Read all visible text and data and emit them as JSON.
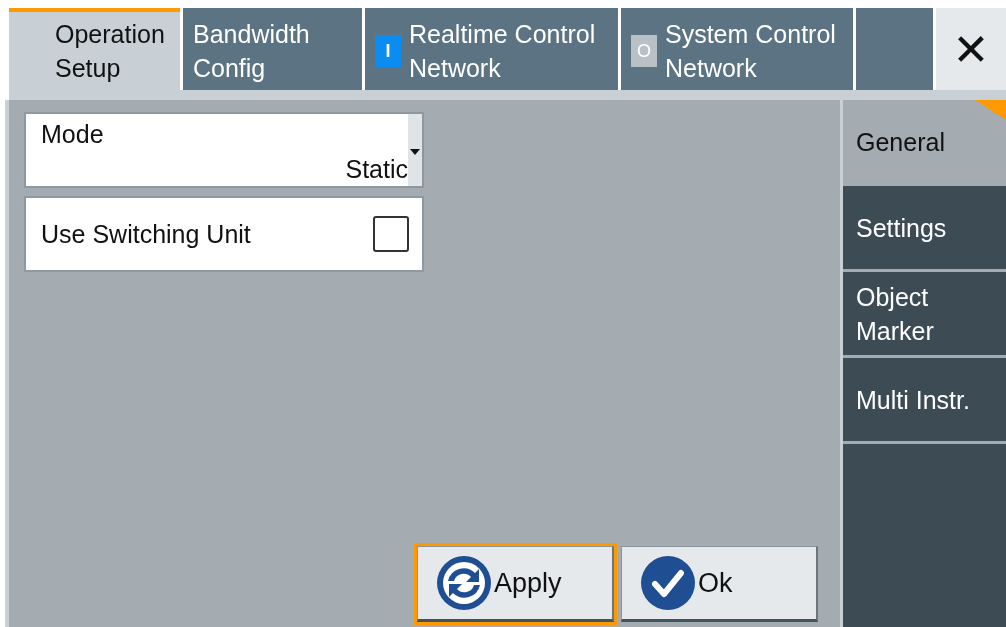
{
  "tabs": [
    {
      "label": "Operation Setup",
      "selected": true
    },
    {
      "label": "Bandwidth Config",
      "selected": false
    },
    {
      "label": "Realtime Control Network",
      "selected": false,
      "indicator": {
        "text": "I",
        "on": true
      }
    },
    {
      "label": "System Control Network",
      "selected": false,
      "indicator": {
        "text": "O",
        "on": false
      }
    }
  ],
  "close_button": {
    "label": "✕"
  },
  "mode": {
    "label": "Mode",
    "value": "Static"
  },
  "use_switching_unit": {
    "label": "Use Switching Unit",
    "checked": false
  },
  "side_tabs": [
    {
      "label": "General",
      "selected": true
    },
    {
      "label": "Settings",
      "selected": false
    },
    {
      "label": "Object Marker",
      "selected": false
    },
    {
      "label": "Multi Instr.",
      "selected": false
    }
  ],
  "buttons": [
    {
      "label": "Apply",
      "kind": "apply",
      "focused": true
    },
    {
      "label": "Ok",
      "kind": "ok",
      "focused": false
    }
  ]
}
